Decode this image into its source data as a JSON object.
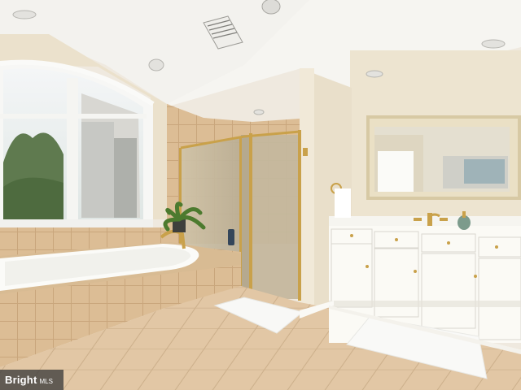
{
  "photo": {
    "watermark_brand": "Bright",
    "watermark_suffix": "MLS"
  },
  "colors": {
    "ceiling": "#f7f6f2",
    "wall": "#ece3cf",
    "tile": "#d8b88e",
    "floor": "#ddc2a0",
    "cabinet": "#faf9f4",
    "glass": "#c9bda3",
    "gold": "#c9a14a"
  }
}
